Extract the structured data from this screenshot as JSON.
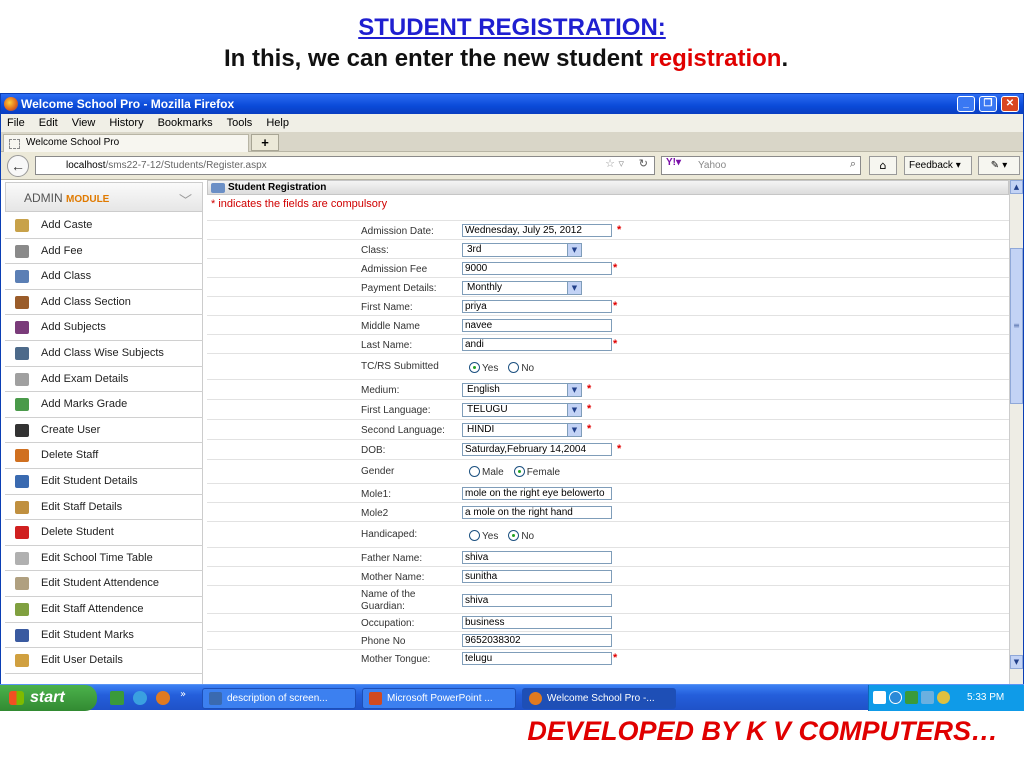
{
  "slide": {
    "title": "STUDENT REGISTRATION:",
    "subtitle_pre": "In this, we can enter the new student ",
    "subtitle_highlight": "registration",
    "subtitle_post": ".",
    "footer": "DEVELOPED BY K V COMPUTERS…"
  },
  "browser": {
    "window_title": "Welcome School Pro - Mozilla Firefox",
    "menu": [
      "File",
      "Edit",
      "View",
      "History",
      "Bookmarks",
      "Tools",
      "Help"
    ],
    "tab_label": "Welcome School Pro",
    "new_tab": "+",
    "url_host": "localhost",
    "url_path": "/sms22-7-12/Students/Register.aspx",
    "search_placeholder": "Yahoo",
    "feedback_label": "Feedback ▾"
  },
  "sidebar": {
    "module_prefix": "ADMIN",
    "module_suffix": "MODULE",
    "items": [
      {
        "label": "Add Caste",
        "color": "#c8a24a"
      },
      {
        "label": "Add Fee",
        "color": "#8a8a8a"
      },
      {
        "label": "Add Class",
        "color": "#5b7fb5"
      },
      {
        "label": "Add Class Section",
        "color": "#9a5c2a"
      },
      {
        "label": "Add Subjects",
        "color": "#7a3b7a"
      },
      {
        "label": "Add Class Wise Subjects",
        "color": "#4d6a8a"
      },
      {
        "label": "Add Exam Details",
        "color": "#a0a0a0"
      },
      {
        "label": "Add Marks Grade",
        "color": "#4a9a4a"
      },
      {
        "label": "Create User",
        "color": "#333333"
      },
      {
        "label": "Delete Staff",
        "color": "#d07020"
      },
      {
        "label": "Edit Student Details",
        "color": "#3a6ab0"
      },
      {
        "label": "Edit Staff Details",
        "color": "#c09040"
      },
      {
        "label": "Delete Student",
        "color": "#d02020"
      },
      {
        "label": "Edit School Time Table",
        "color": "#b0b0b0"
      },
      {
        "label": "Edit Student Attendence",
        "color": "#b0a080"
      },
      {
        "label": "Edit Staff Attendence",
        "color": "#80a040"
      },
      {
        "label": "Edit Student Marks",
        "color": "#3a5aa0"
      },
      {
        "label": "Edit User Details",
        "color": "#d0a040"
      }
    ]
  },
  "form": {
    "panel_title": "Student Registration",
    "compulsory_note": "* indicates the fields are compulsory",
    "admission_date_label": "Admission Date:",
    "admission_date": "Wednesday, July 25, 2012",
    "class_label": "Class:",
    "class": "3rd",
    "admission_fee_label": "Admission Fee",
    "admission_fee": "9000",
    "payment_label": "Payment Details:",
    "payment": "Monthly",
    "first_name_label": "First Name:",
    "first_name": "priya",
    "middle_name_label": "Middle Name",
    "middle_name": "navee",
    "last_name_label": "Last Name:",
    "last_name": "andi",
    "tcrs_label": "TC/RS Submitted",
    "tcrs_yes": "Yes",
    "tcrs_no": "No",
    "medium_label": "Medium:",
    "medium": "English",
    "first_lang_label": "First Language:",
    "first_lang": "TELUGU",
    "second_lang_label": "Second Language:",
    "second_lang": "HINDI",
    "dob_label": "DOB:",
    "dob": "Saturday,February 14,2004",
    "gender_label": "Gender",
    "gender_male": "Male",
    "gender_female": "Female",
    "mole1_label": "Mole1:",
    "mole1": "mole on the right eye belowerto",
    "mole2_label": "Mole2",
    "mole2": "a mole on the right hand",
    "handicaped_label": "Handicaped:",
    "handicaped_yes": "Yes",
    "handicaped_no": "No",
    "father_label": "Father Name:",
    "father": "shiva",
    "mother_label": "Mother Name:",
    "mother": "sunitha",
    "guardian_label_1": "Name of the",
    "guardian_label_2": "Guardian:",
    "guardian": "shiva",
    "occupation_label": "Occupation:",
    "occupation": "business",
    "phone_label": "Phone No",
    "phone": "9652038302",
    "tongue_label": "Mother Tongue:",
    "tongue": "telugu",
    "req": "*"
  },
  "taskbar": {
    "start": "start",
    "buttons": [
      {
        "label": "description of screen...",
        "color": "#3a6ab0"
      },
      {
        "label": "Microsoft PowerPoint ...",
        "color": "#d04a20"
      },
      {
        "label": "Welcome School Pro -...",
        "color": "#e07a20"
      }
    ],
    "clock": "5:33 PM"
  }
}
